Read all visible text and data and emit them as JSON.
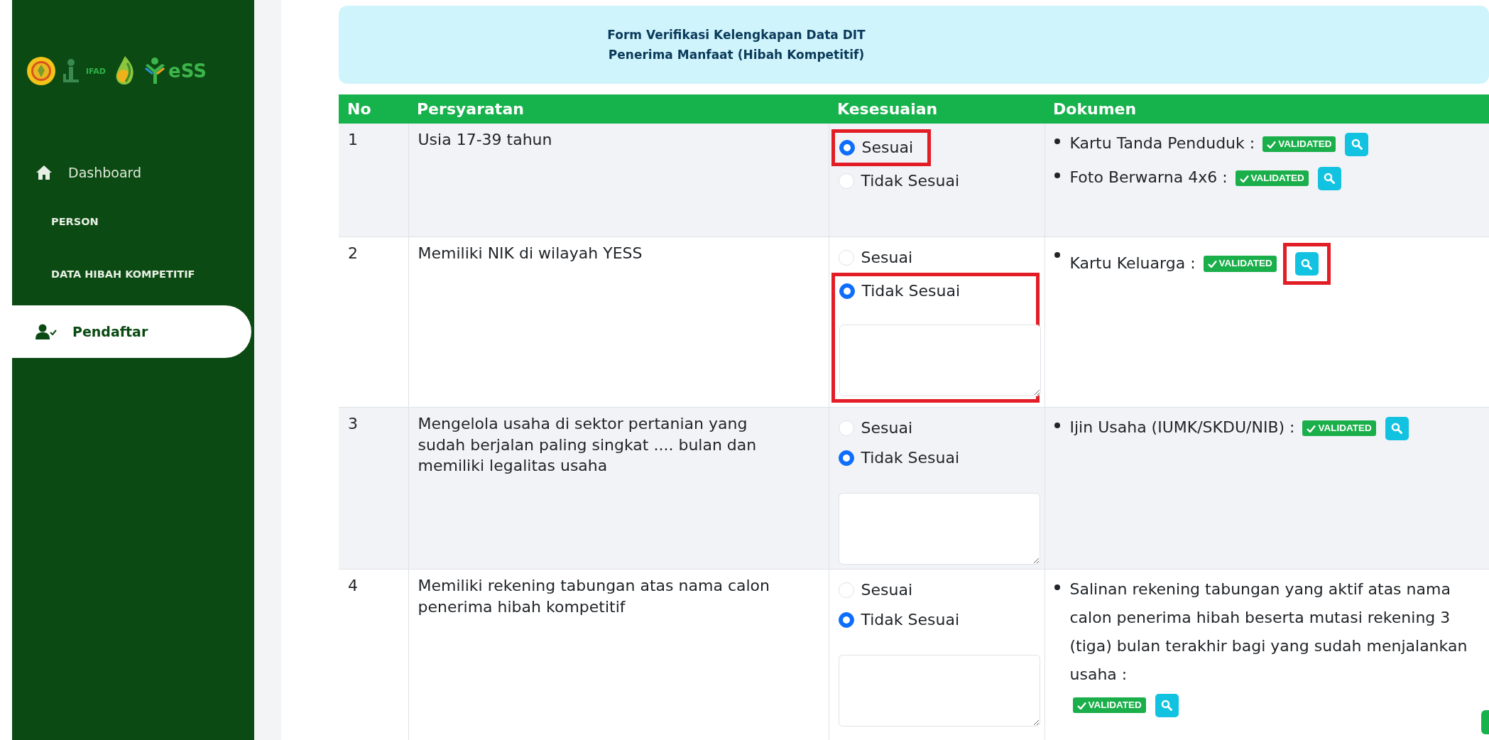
{
  "sidebar": {
    "logos": [
      {
        "kind": "emblem"
      },
      {
        "kind": "ifad",
        "text": "IFAD"
      },
      {
        "kind": "flame"
      },
      {
        "kind": "yess",
        "text": "eSS"
      }
    ],
    "items": [
      {
        "kind": "home",
        "label": "Dashboard",
        "selected": false
      },
      {
        "kind": "heading",
        "label": "PERSON",
        "selected": false
      },
      {
        "kind": "heading",
        "label": "DATA HIBAH KOMPETITIF",
        "selected": false
      },
      {
        "kind": "registrant",
        "label": "Pendaftar",
        "selected": true
      }
    ]
  },
  "header": {
    "lines": [
      "Form Verifikasi Kelengkapan Data DIT",
      "Penerima Manfaat (Hibah Kompetitif)"
    ]
  },
  "table": {
    "columns": [
      "No",
      "Persyaratan",
      "Kesesuaian",
      "Dokumen"
    ],
    "rows": [
      {
        "no": "1",
        "requirement": "Usia 17-39 tahun",
        "options": [
          {
            "label": "Sesuai",
            "selected": true,
            "highlighted": true
          },
          {
            "label": "Tidak Sesuai",
            "selected": false,
            "highlighted": false
          }
        ],
        "has_note": false,
        "documents": [
          {
            "name": "Kartu Tanda Penduduk :",
            "badge": "VALIDATED",
            "highlighted": false
          },
          {
            "name": "Foto Berwarna 4x6 :",
            "badge": "VALIDATED",
            "highlighted": false
          }
        ]
      },
      {
        "no": "2",
        "requirement": "Memiliki NIK di wilayah YESS",
        "options": [
          {
            "label": "Sesuai",
            "selected": false,
            "highlighted": false
          },
          {
            "label": "Tidak Sesuai",
            "selected": true,
            "highlighted": true
          }
        ],
        "has_note": true,
        "documents": [
          {
            "name": "Kartu Keluarga :",
            "badge": "VALIDATED",
            "highlighted": true
          }
        ]
      },
      {
        "no": "3",
        "requirement": "Mengelola usaha di sektor pertanian yang sudah berjalan paling singkat .... bulan dan memiliki legalitas usaha",
        "options": [
          {
            "label": "Sesuai",
            "selected": false,
            "highlighted": false
          },
          {
            "label": "Tidak Sesuai",
            "selected": true,
            "highlighted": false
          }
        ],
        "has_note": true,
        "documents": [
          {
            "name": "Ijin Usaha (IUMK/SKDU/NIB) :",
            "badge": "VALIDATED",
            "highlighted": false
          }
        ]
      },
      {
        "no": "4",
        "requirement": "Memiliki rekening tabungan atas nama calon penerima hibah kompetitif",
        "options": [
          {
            "label": "Sesuai",
            "selected": false,
            "highlighted": false
          },
          {
            "label": "Tidak Sesuai",
            "selected": true,
            "highlighted": false
          }
        ],
        "has_note": true,
        "documents": [
          {
            "name": "Salinan rekening tabungan yang aktif atas nama calon penerima hibah beserta mutasi rekening 3 (tiga) bulan terakhir bagi yang sudah menjalankan usaha :",
            "badge": "VALIDATED",
            "highlighted": false
          }
        ]
      }
    ]
  }
}
